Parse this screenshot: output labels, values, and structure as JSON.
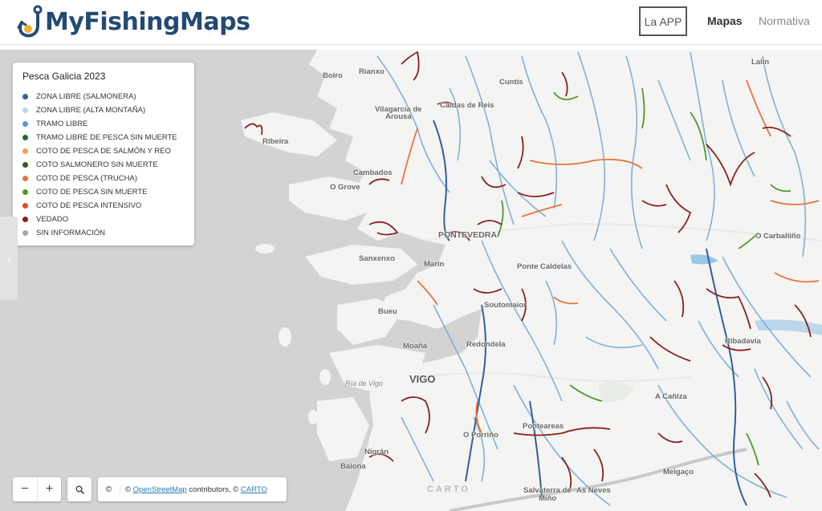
{
  "header": {
    "logo_text": "MyFishingMaps",
    "nav": {
      "app": "La APP",
      "maps": "Mapas",
      "rules": "Normativa"
    }
  },
  "legend": {
    "title": "Pesca Galicia 2023",
    "items": [
      {
        "label": "ZONA LIBRE (SALMONERA)",
        "color": "#2f5f9f"
      },
      {
        "label": "ZONA LIBRE (ALTA MONTAÑA)",
        "color": "#b3d6ee"
      },
      {
        "label": "TRAMO LIBRE",
        "color": "#5b9bd0"
      },
      {
        "label": "TRAMO LIBRE DE PESCA SIN MUERTE",
        "color": "#1f6b2a"
      },
      {
        "label": "COTO DE PESCA DE SALMÓN Y REO",
        "color": "#f0a050"
      },
      {
        "label": "COTO SALMONERO SIN MUERTE",
        "color": "#2d5a1b"
      },
      {
        "label": "COTO DE PESCA (TRUCHA)",
        "color": "#e8743b"
      },
      {
        "label": "COTO DE PESCA SIN MUERTE",
        "color": "#4b9a2e"
      },
      {
        "label": "COTO DE PESCA INTENSIVO",
        "color": "#e14b2c"
      },
      {
        "label": "VEDADO",
        "color": "#8a1f1f"
      },
      {
        "label": "SIN INFORMACIÓN",
        "color": "#a8a8a8"
      }
    ]
  },
  "places": {
    "boiro": "Boiro",
    "rianxo": "Rianxo",
    "cuntis": "Cuntis",
    "lalin": "Lalín",
    "vilagarcia_1": "Vilagarcía de",
    "vilagarcia_2": "Arousa",
    "caldas": "Caldas de Reis",
    "ribeira": "Ribeira",
    "cambados": "Cambados",
    "ogrove": "O Grove",
    "pontevedra": "PONTEVEDRA",
    "carballino": "O Carballiño",
    "sanxenxo": "Sanxenxo",
    "marin": "Marín",
    "pontecaldelas": "Ponte Caldelas",
    "soutomaior": "Soutomaior",
    "bueu": "Bueu",
    "ribadavia": "Ribadavia",
    "moana": "Moaña",
    "redondela": "Redondela",
    "riadevigo": "Ría de Vigo",
    "vigo": "VIGO",
    "acaniza": "A Cañiza",
    "pontareas": "Ponteareas",
    "oporrino": "O Porriño",
    "nigran": "Nigrán",
    "baiona": "Baiona",
    "melgaco": "Melgaço",
    "salvaterra": "Salvaterra de",
    "asneves": "As Neves",
    "mino": "Miño"
  },
  "controls": {
    "zoom_out": "−",
    "zoom_in": "+",
    "attribution_copy": "©",
    "attribution_prefix": "©",
    "osm_link": "OpenStreetMap",
    "attribution_mid": "contributors, ©",
    "carto_link": "CARTO",
    "carto_logo": "CARTO"
  },
  "rivers": {
    "salmon_free": "#2f5f9f",
    "free": "#7fb0dc",
    "vedado": "#8a1f1f",
    "trout": "#e8743b",
    "catch_release": "#4b9a2e",
    "no_info": "#a8a8a8"
  }
}
